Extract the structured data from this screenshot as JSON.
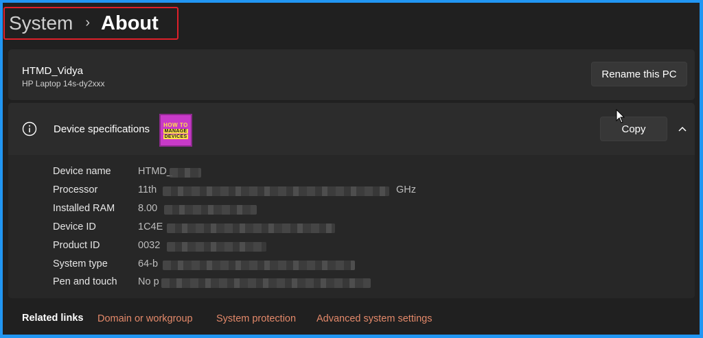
{
  "breadcrumb": {
    "parent": "System",
    "separator": "›",
    "current": "About"
  },
  "device": {
    "name": "HTMD_Vidya",
    "model": "HP Laptop 14s-dy2xxx",
    "rename_label": "Rename this PC"
  },
  "specs": {
    "title": "Device specifications",
    "copy_label": "Copy",
    "logo": {
      "line1": "HOW TO",
      "line2": "MANAGE",
      "line3": "DEVICES"
    },
    "rows": [
      {
        "label": "Device name",
        "value": "HTMD_",
        "suffix": ""
      },
      {
        "label": "Processor",
        "value": "11th",
        "suffix": "GHz"
      },
      {
        "label": "Installed RAM",
        "value": "8.00",
        "suffix": ""
      },
      {
        "label": "Device ID",
        "value": "1C4E",
        "suffix": ""
      },
      {
        "label": "Product ID",
        "value": "0032",
        "suffix": ""
      },
      {
        "label": "System type",
        "value": "64-b",
        "suffix": ""
      },
      {
        "label": "Pen and touch",
        "value": "No p",
        "suffix": ""
      }
    ]
  },
  "related": {
    "title": "Related links",
    "links": [
      "Domain or workgroup",
      "System protection",
      "Advanced system settings"
    ]
  },
  "icons": {
    "info": "info-icon",
    "chevron": "chevron-up-icon",
    "cursor": "mouse-pointer-icon"
  },
  "colors": {
    "link": "#e4896a",
    "highlight_border": "#e0202a",
    "frame": "#2196f3"
  }
}
